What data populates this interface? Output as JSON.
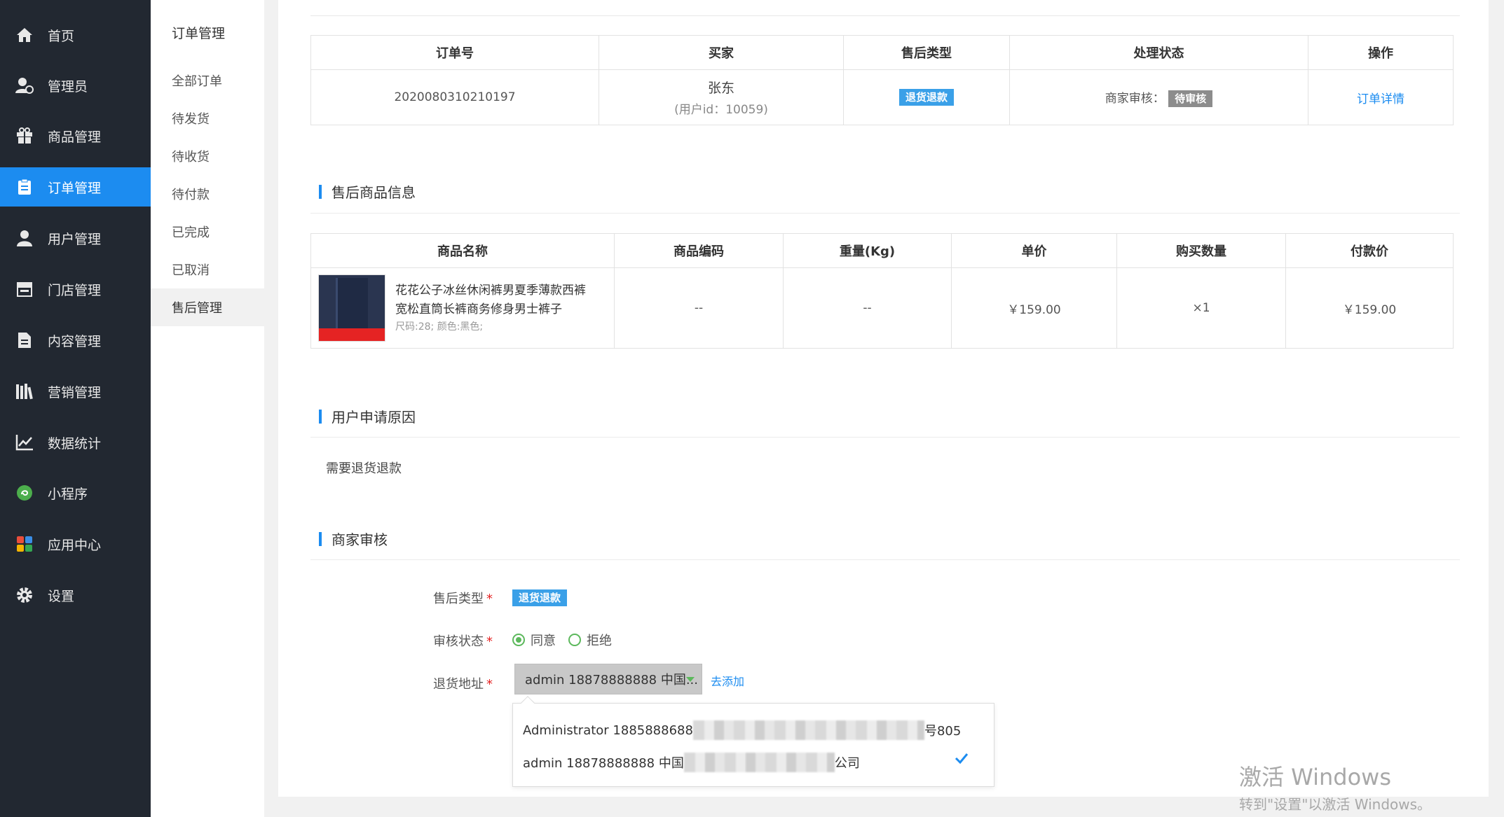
{
  "sidebar": {
    "items": [
      {
        "label": "首页",
        "icon": "home-icon"
      },
      {
        "label": "管理员",
        "icon": "admin-user-icon"
      },
      {
        "label": "商品管理",
        "icon": "gift-icon"
      },
      {
        "label": "订单管理",
        "icon": "clipboard-icon"
      },
      {
        "label": "用户管理",
        "icon": "user-icon"
      },
      {
        "label": "门店管理",
        "icon": "store-icon"
      },
      {
        "label": "内容管理",
        "icon": "document-icon"
      },
      {
        "label": "营销管理",
        "icon": "books-icon"
      },
      {
        "label": "数据统计",
        "icon": "line-chart-icon"
      },
      {
        "label": "小程序",
        "icon": "miniprogram-icon"
      },
      {
        "label": "应用中心",
        "icon": "apps-icon"
      },
      {
        "label": "设置",
        "icon": "gear-icon"
      }
    ],
    "active_index": 3
  },
  "subnav": {
    "title": "订单管理",
    "items": [
      "全部订单",
      "待发货",
      "待收货",
      "待付款",
      "已完成",
      "已取消",
      "售后管理"
    ],
    "active_index": 6
  },
  "order_table": {
    "headers": [
      "订单号",
      "买家",
      "售后类型",
      "处理状态",
      "操作"
    ],
    "row": {
      "order_no": "2020080310210197",
      "buyer_name": "张东",
      "buyer_id": "(用户id：10059)",
      "aftersale_type": "退货退款",
      "status_prefix": "商家审核：",
      "status_badge": "待审核",
      "action": "订单详情"
    }
  },
  "goods_section": {
    "title": "售后商品信息",
    "headers": [
      "商品名称",
      "商品编码",
      "重量(Kg)",
      "单价",
      "购买数量",
      "付款价"
    ],
    "row": {
      "name_line1": "花花公子冰丝休闲裤男夏季薄款西裤",
      "name_line2": "宽松直筒长裤商务修身男士裤子",
      "spec": "尺码:28; 颜色:黑色;",
      "code": "--",
      "weight": "--",
      "price": "￥159.00",
      "qty": "×1",
      "paid": "￥159.00"
    }
  },
  "reason_section": {
    "title": "用户申请原因",
    "text": "需要退货退款"
  },
  "review_section": {
    "title": "商家审核",
    "type_label": "售后类型",
    "type_value": "退货退款",
    "status_label": "审核状态",
    "status_options": [
      "同意",
      "拒绝"
    ],
    "status_selected": 0,
    "address_label": "退货地址",
    "address_selected": "admin 18878888888 中国...",
    "add_link": "去添加",
    "address_options": [
      {
        "prefix": "Administrator 1885888688",
        "suffix": "号805"
      },
      {
        "prefix": "admin 18878888888 中国",
        "suffix": "公司"
      }
    ],
    "required_mark": "*"
  },
  "watermark": {
    "line1": "激活 Windows",
    "line2": "转到\"设置\"以激活 Windows。"
  },
  "colors": {
    "sidebar_bg": "#222831",
    "accent": "#1c8cf0",
    "price_red": "#e52323",
    "radio_green": "#5cb85c"
  }
}
